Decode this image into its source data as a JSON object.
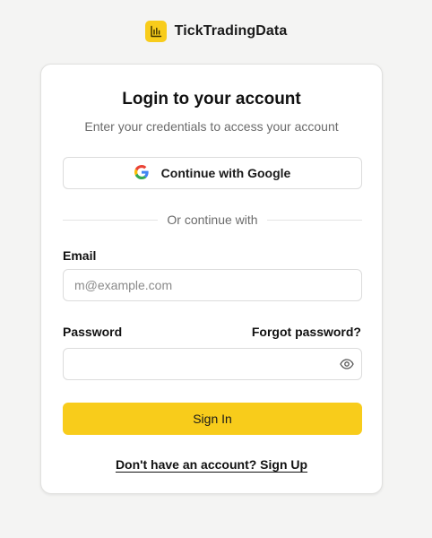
{
  "brand": {
    "name": "TickTradingData",
    "logo_icon": "bar-chart-icon",
    "accent_color": "#f8cc1b"
  },
  "card": {
    "title": "Login to your account",
    "subtitle": "Enter your credentials to access your account"
  },
  "google_button": {
    "label": "Continue with Google",
    "icon": "google-icon"
  },
  "divider": {
    "text": "Or continue with"
  },
  "email": {
    "label": "Email",
    "placeholder": "m@example.com",
    "value": ""
  },
  "password": {
    "label": "Password",
    "forgot_label": "Forgot password?",
    "value": "",
    "toggle_icon": "eye-icon"
  },
  "signin_button": {
    "label": "Sign In"
  },
  "signup": {
    "text": "Don't have an account? Sign Up"
  }
}
